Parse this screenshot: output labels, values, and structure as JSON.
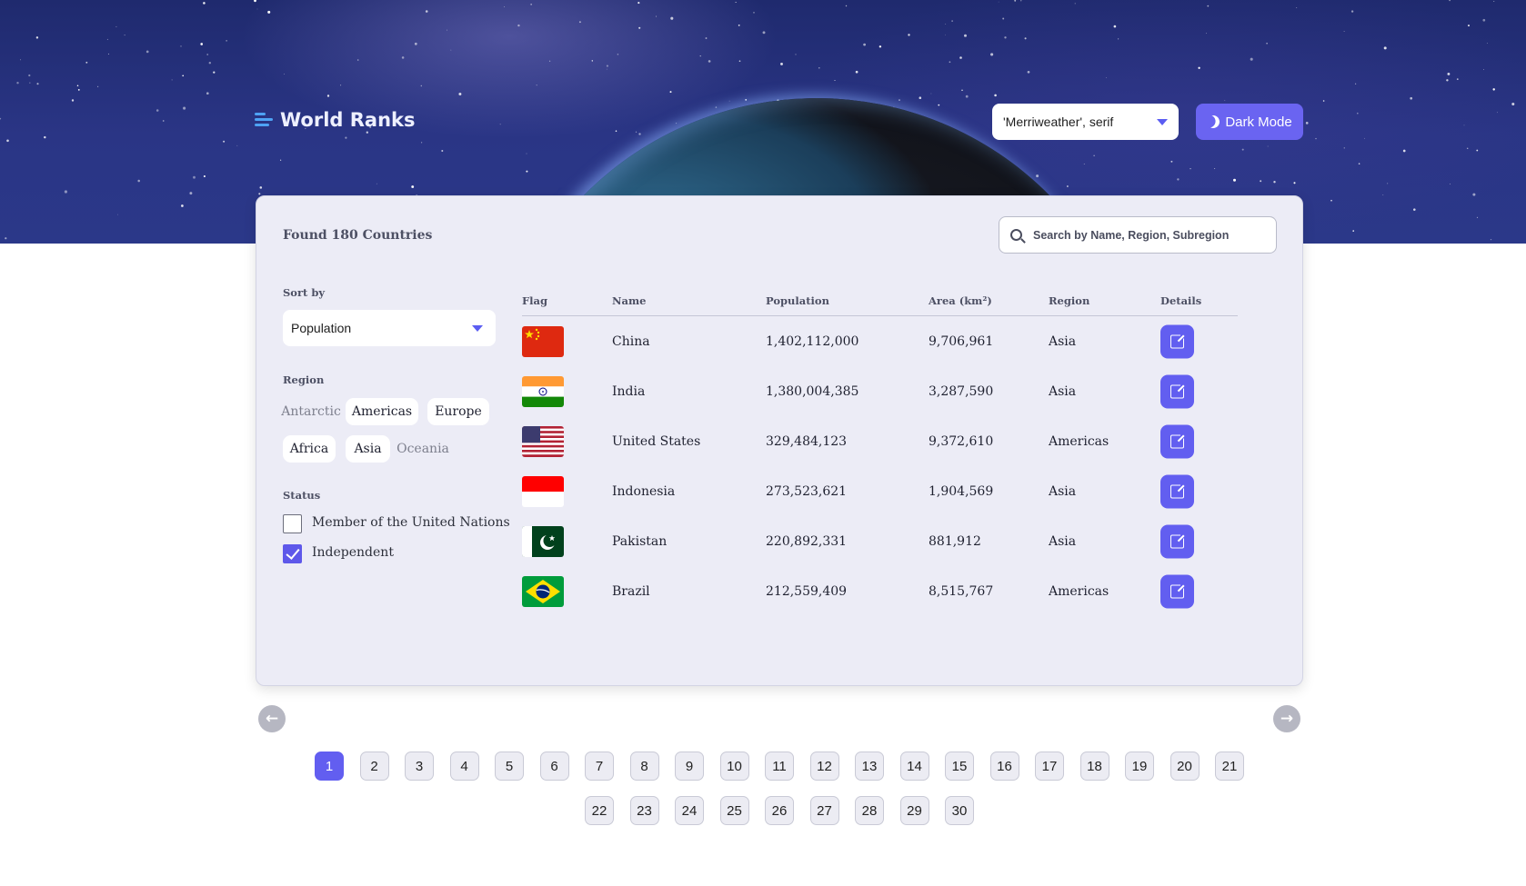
{
  "header": {
    "brand": "World Ranks",
    "font_select_value": "'Merriweather', serif",
    "dark_mode_label": "Dark Mode"
  },
  "summary": {
    "found_text": "Found 180 Countries"
  },
  "search": {
    "placeholder": "Search by Name, Region, Subregion"
  },
  "filters": {
    "sort_label": "Sort by",
    "sort_value": "Population",
    "region_label": "Region",
    "regions": [
      {
        "label": "Antarctic",
        "selected": false
      },
      {
        "label": "Americas",
        "selected": true
      },
      {
        "label": "Europe",
        "selected": true
      },
      {
        "label": "Africa",
        "selected": true
      },
      {
        "label": "Asia",
        "selected": true
      },
      {
        "label": "Oceania",
        "selected": false
      }
    ],
    "status_label": "Status",
    "status": [
      {
        "label": "Member of the United Nations",
        "checked": false
      },
      {
        "label": "Independent",
        "checked": true
      }
    ]
  },
  "table": {
    "headers": [
      "Flag",
      "Name",
      "Population",
      "Area (km²)",
      "Region",
      "Details"
    ],
    "rows": [
      {
        "flag": "china-flag",
        "name": "China",
        "population": "1,402,112,000",
        "area": "9,706,961",
        "region": "Asia"
      },
      {
        "flag": "india-flag",
        "name": "India",
        "population": "1,380,004,385",
        "area": "3,287,590",
        "region": "Asia"
      },
      {
        "flag": "usa-flag",
        "name": "United States",
        "population": "329,484,123",
        "area": "9,372,610",
        "region": "Americas"
      },
      {
        "flag": "indonesia-flag",
        "name": "Indonesia",
        "population": "273,523,621",
        "area": "1,904,569",
        "region": "Asia"
      },
      {
        "flag": "pakistan-flag",
        "name": "Pakistan",
        "population": "220,892,331",
        "area": "881,912",
        "region": "Asia"
      },
      {
        "flag": "brazil-flag",
        "name": "Brazil",
        "population": "212,559,409",
        "area": "8,515,767",
        "region": "Americas"
      }
    ]
  },
  "pagination": {
    "current": "1",
    "pages": [
      "1",
      "2",
      "3",
      "4",
      "5",
      "6",
      "7",
      "8",
      "9",
      "10",
      "11",
      "12",
      "13",
      "14",
      "15",
      "16",
      "17",
      "18",
      "19",
      "20",
      "21",
      "22",
      "23",
      "24",
      "25",
      "26",
      "27",
      "28",
      "29",
      "30"
    ],
    "prev_icon": "arrow-left-icon",
    "next_icon": "arrow-right-icon"
  },
  "colors": {
    "accent": "#625EF0",
    "hero": "#2A3585",
    "card": "#ECECF6"
  }
}
